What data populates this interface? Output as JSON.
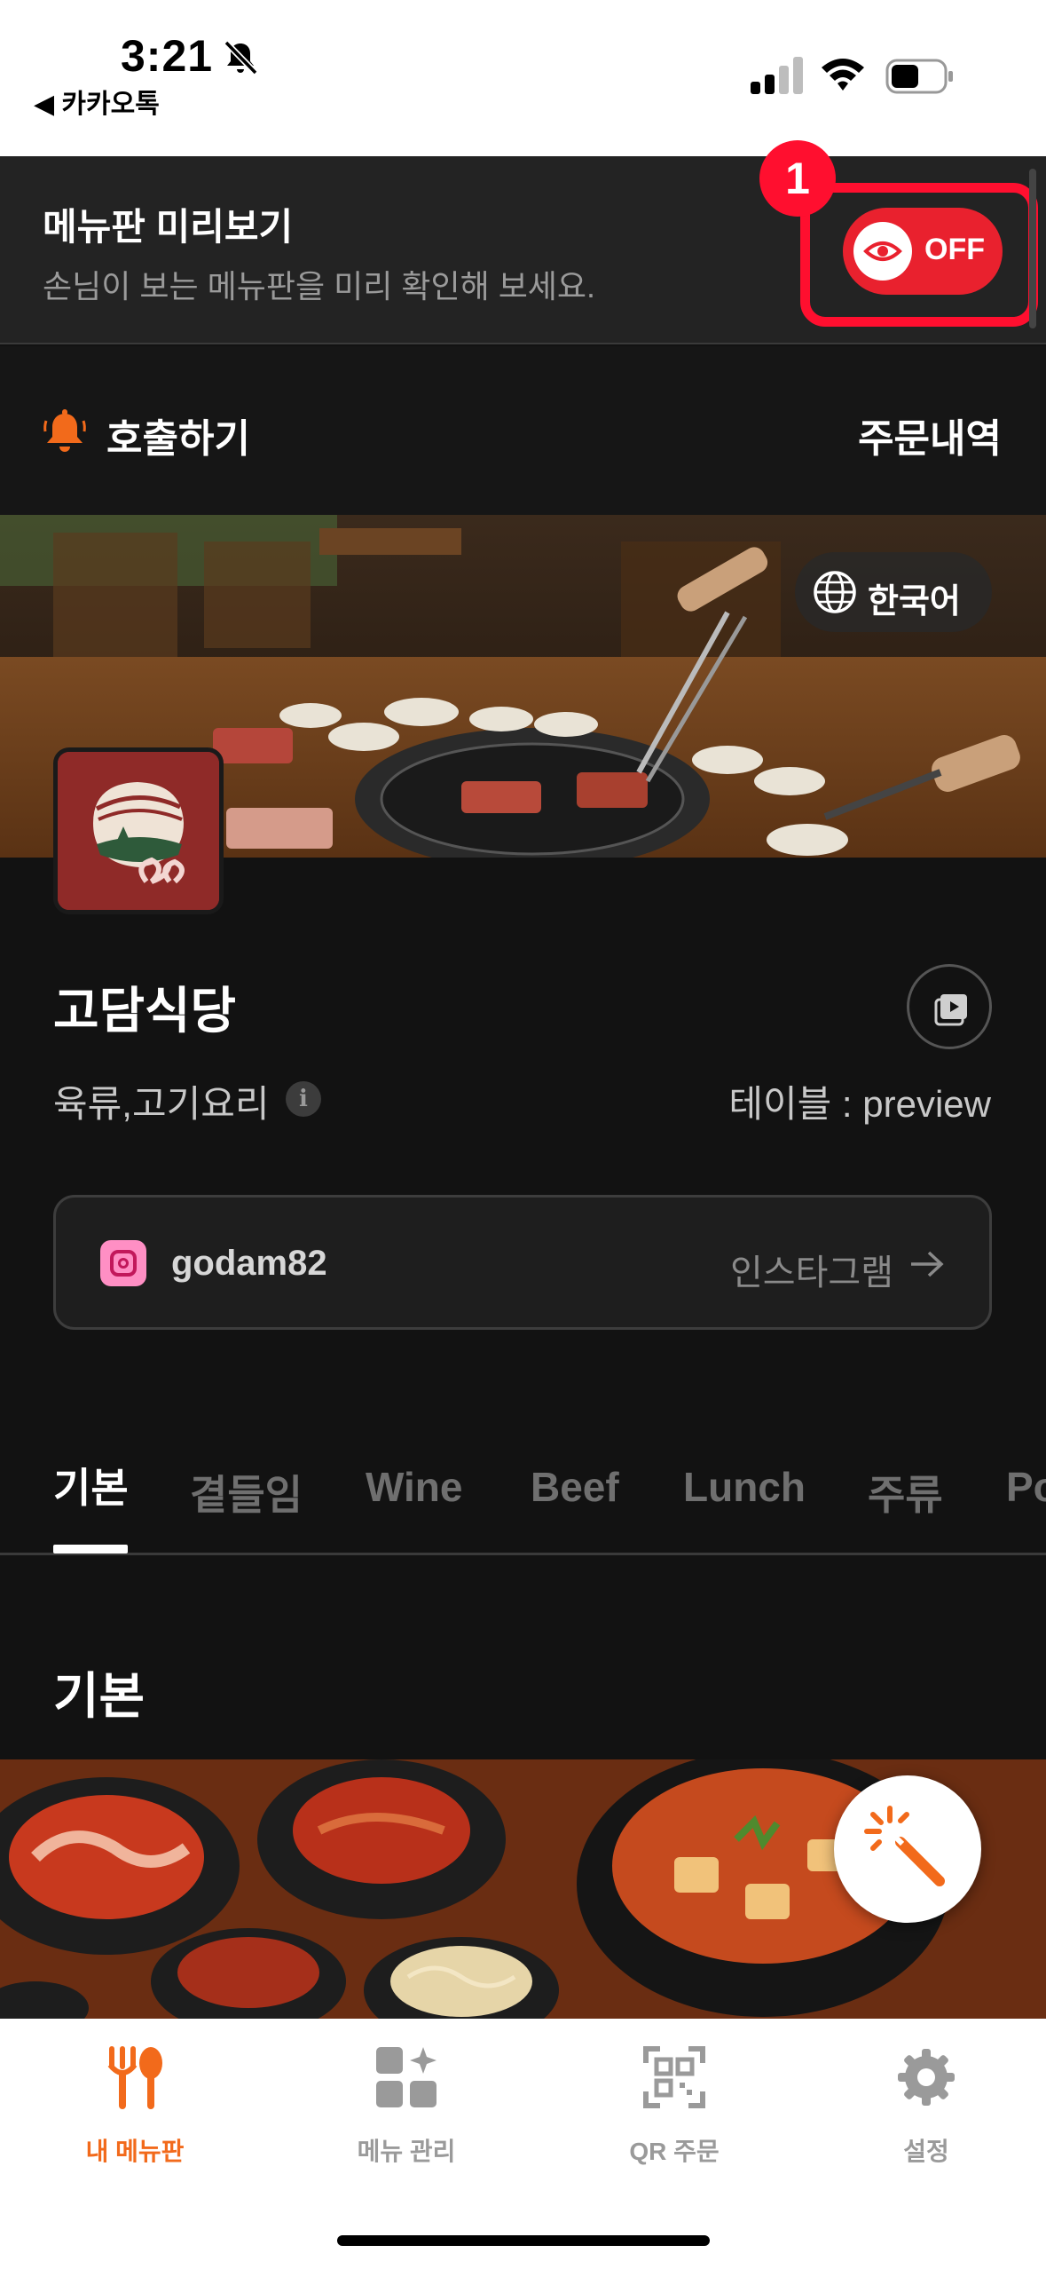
{
  "status_bar": {
    "time": "3:21",
    "back_app": "◀ 카카오톡"
  },
  "preview": {
    "title": "메뉴판 미리보기",
    "subtitle": "손님이 보는 메뉴판을 미리 확인해 보세요.",
    "toggle_label": "OFF",
    "step_badge": "1"
  },
  "call_row": {
    "call_label": "호출하기",
    "orders_label": "주문내역"
  },
  "hero": {
    "language_label": "한국어"
  },
  "store": {
    "name": "고담식당",
    "category": "육류,고기요리",
    "info_icon": "i",
    "table": "테이블 : preview",
    "instagram_handle": "godam82",
    "instagram_link": "인스타그램"
  },
  "tabs": [
    {
      "label": "기본"
    },
    {
      "label": "곁들임"
    },
    {
      "label": "Wine"
    },
    {
      "label": "Beef"
    },
    {
      "label": "Lunch"
    },
    {
      "label": "주류"
    },
    {
      "label": "Po"
    }
  ],
  "section": {
    "title": "기본"
  },
  "bottom_nav": [
    {
      "label": "내 메뉴판",
      "icon": "fork-spoon-icon"
    },
    {
      "label": "메뉴 관리",
      "icon": "grid-sparkle-icon"
    },
    {
      "label": "QR 주문",
      "icon": "qr-code-icon"
    },
    {
      "label": "설정",
      "icon": "gear-icon"
    }
  ],
  "colors": {
    "accent_orange": "#f26a1b",
    "toggle_red": "#e9212e",
    "highlight_red": "#ff0f2f",
    "background": "#121212"
  }
}
